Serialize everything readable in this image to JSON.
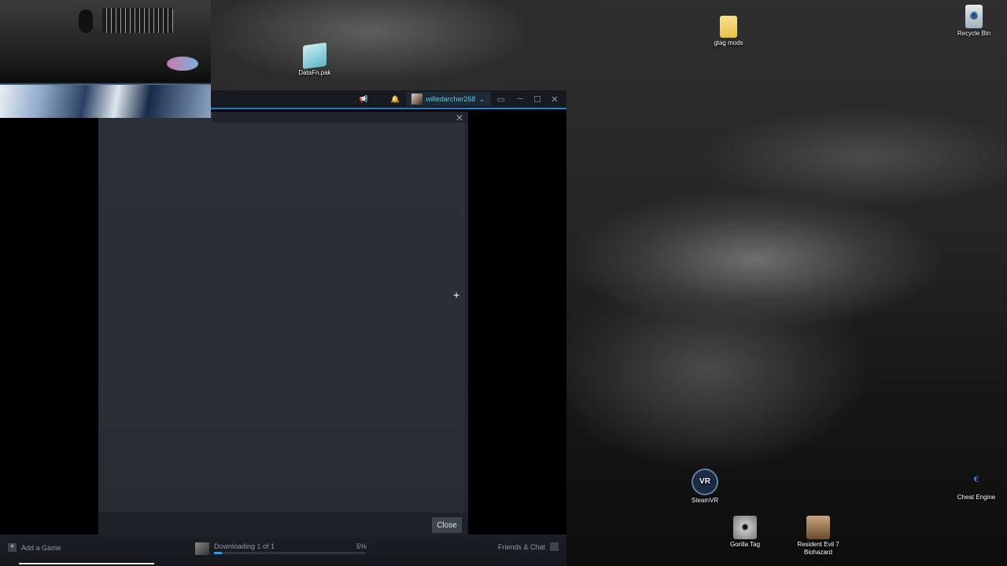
{
  "desktop": {
    "icons": [
      {
        "label": "DataFn.pak",
        "glyph": ""
      },
      {
        "label": "gtag mods",
        "glyph": ""
      },
      {
        "label": "Recycle Bin",
        "glyph": "♻"
      },
      {
        "label": "SteamVR",
        "glyph": "VR"
      },
      {
        "label": "Cheat Engine",
        "glyph": "€"
      },
      {
        "label": "Gorilla Tag",
        "glyph": "☻"
      },
      {
        "label": "Resident Evil 7 Biohazard",
        "glyph": ""
      }
    ]
  },
  "steam": {
    "account_name": "willedarcher268",
    "account_chevron": "⌄",
    "icons": {
      "announce": "📢",
      "bell": "🔔",
      "bigpicture": "▭",
      "minimize": "─",
      "maximize": "☐",
      "close": "✕"
    },
    "dialog": {
      "close_x": "✕",
      "crosshair": "+",
      "close_button": "Close"
    },
    "bottom": {
      "add_game": "Add a Game",
      "add_game_glyph": "+",
      "download_status": "Downloading 1 of 1",
      "download_percent_text": "5%",
      "download_progress": 0.05,
      "friends": "Friends & Chat"
    }
  },
  "colors": {
    "accent": "#1a9fff",
    "account": "#57cbde"
  }
}
